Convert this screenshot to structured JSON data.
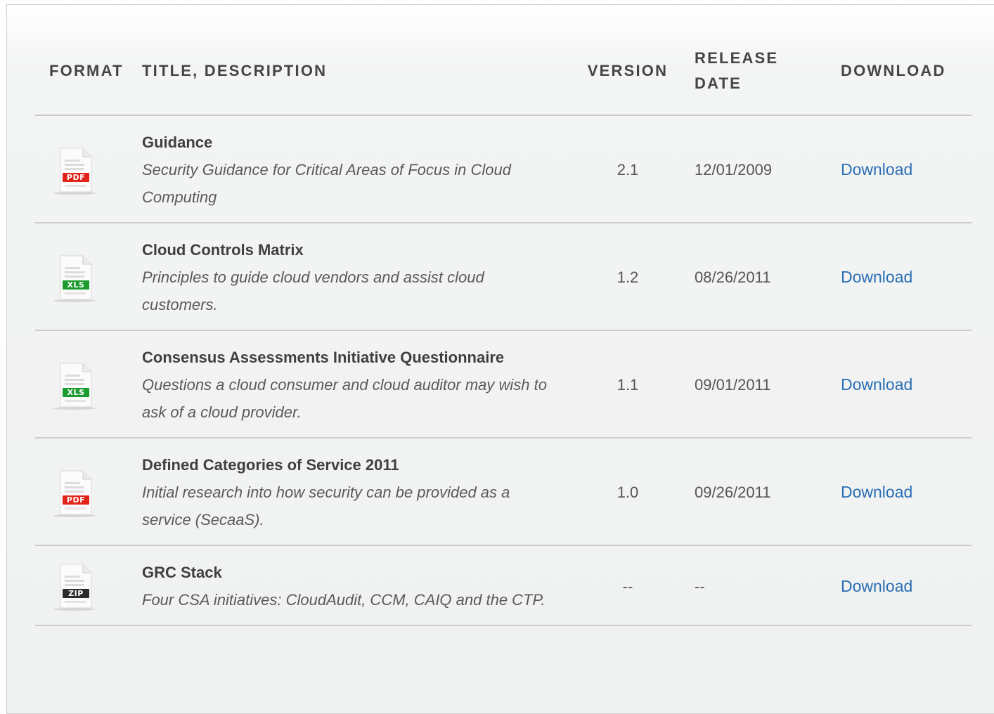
{
  "table": {
    "headers": {
      "format": "FORMAT",
      "title": "TITLE, DESCRIPTION",
      "version": "VERSION",
      "release": "RELEASE DATE",
      "download": "DOWNLOAD"
    },
    "rows": [
      {
        "format": "PDF",
        "format_color": "#e2231a",
        "title": "Guidance",
        "description": "Security Guidance for Critical Areas of Focus in Cloud Computing",
        "version": "2.1",
        "release_date": "12/01/2009",
        "download_label": "Download"
      },
      {
        "format": "XLS",
        "format_color": "#1c9b2e",
        "title": "Cloud Controls Matrix",
        "description": "Principles to guide cloud vendors and assist cloud customers.",
        "version": "1.2",
        "release_date": "08/26/2011",
        "download_label": "Download"
      },
      {
        "format": "XLS",
        "format_color": "#1c9b2e",
        "title": "Consensus Assessments Initiative Questionnaire",
        "description": "Questions a cloud consumer and cloud auditor may wish to ask of a cloud provider.",
        "version": "1.1",
        "release_date": "09/01/2011",
        "download_label": "Download"
      },
      {
        "format": "PDF",
        "format_color": "#e2231a",
        "title": "Defined Categories of Service 2011",
        "description": "Initial research into how security can be provided as a service (SecaaS).",
        "version": "1.0",
        "release_date": "09/26/2011",
        "download_label": "Download"
      },
      {
        "format": "ZIP",
        "format_color": "#2b2b2b",
        "title": "GRC Stack",
        "description": "Four CSA initiatives: CloudAudit, CCM, CAIQ and the CTP.",
        "version": "--",
        "release_date": "--",
        "download_label": "Download"
      }
    ]
  },
  "colors": {
    "link": "#2a6fb5",
    "header_text": "#454545",
    "border": "#cccccc"
  },
  "icons": {
    "pdf": "pdf-file-icon",
    "xls": "xls-file-icon",
    "zip": "zip-file-icon"
  }
}
